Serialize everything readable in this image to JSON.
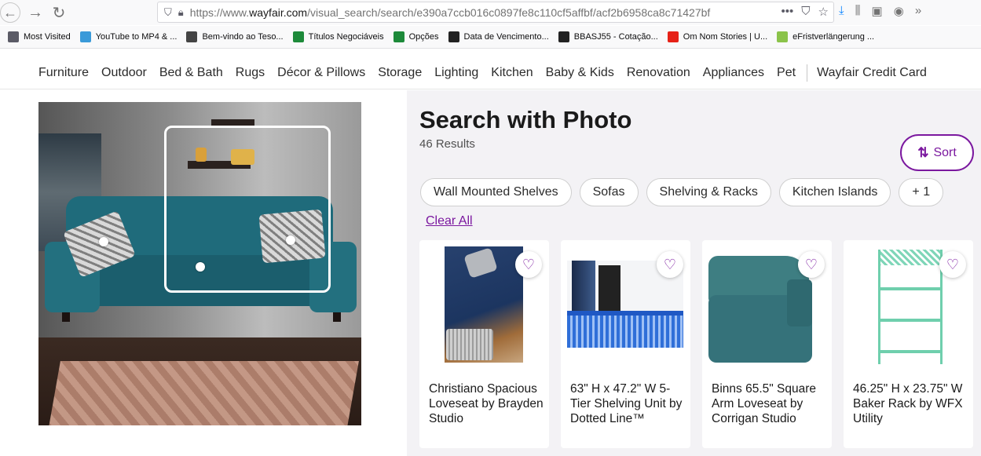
{
  "browser": {
    "url_prefix": "https://www.",
    "url_domain": "wayfair.com",
    "url_rest": "/visual_search/search/e390a7ccb016c0897fe8c110cf5affbf/acf2b6958ca8c71427bf",
    "menu_dots": "•••",
    "bookmarks": [
      {
        "label": "Most Visited",
        "icon": "gear-icon",
        "color": "#5b5b66"
      },
      {
        "label": "YouTube to MP4 & ...",
        "icon": "youtube-mp4-icon",
        "color": "#3a9ad9"
      },
      {
        "label": "Bem-vindo ao Teso...",
        "icon": "globe-icon",
        "color": "#444444"
      },
      {
        "label": "Títulos Negociáveis",
        "icon": "chart-icon",
        "color": "#1d8a3a"
      },
      {
        "label": "Opções",
        "icon": "chart-icon",
        "color": "#1d8a3a"
      },
      {
        "label": "Data de Vencimento...",
        "icon": "bars-icon",
        "color": "#222222"
      },
      {
        "label": "BBASJ55 - Cotação...",
        "icon": "bars-icon",
        "color": "#222222"
      },
      {
        "label": "Om Nom Stories | U...",
        "icon": "youtube-icon",
        "color": "#e62117"
      },
      {
        "label": "eFristverlängerung ...",
        "icon": "efrist-icon",
        "color": "#8bc34a"
      }
    ]
  },
  "site_nav": {
    "items": [
      "Furniture",
      "Outdoor",
      "Bed & Bath",
      "Rugs",
      "Décor & Pillows",
      "Storage",
      "Lighting",
      "Kitchen",
      "Baby & Kids",
      "Renovation",
      "Appliances",
      "Pet"
    ],
    "credit": "Wayfair Credit Card"
  },
  "search": {
    "title": "Search with Photo",
    "results": "46 Results",
    "sort_label": "Sort",
    "chips": [
      "Wall Mounted Shelves",
      "Sofas",
      "Shelving & Racks",
      "Kitchen Islands",
      "+ 1"
    ],
    "clear_all": "Clear All"
  },
  "products": [
    {
      "name": "Christiano Spacious Loveseat by Brayden Studio"
    },
    {
      "name": "63\" H x 47.2\" W 5-Tier Shelving Unit by Dotted Line™"
    },
    {
      "name": "Binns 65.5\" Square Arm Loveseat by Corrigan Studio"
    },
    {
      "name": "46.25\" H x 23.75\" W Baker Rack by WFX Utility"
    }
  ],
  "colors": {
    "accent": "#7b189f",
    "panel_bg": "#f3f2f5"
  }
}
